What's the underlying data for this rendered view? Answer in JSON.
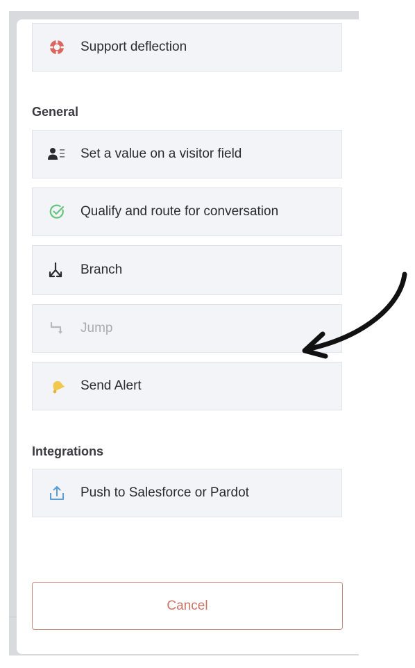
{
  "items_top": [
    {
      "label": "Support deflection",
      "icon": "lifebuoy-icon",
      "icon_color": "#d9675d"
    }
  ],
  "general": {
    "heading": "General",
    "items": [
      {
        "label": "Set a value on a visitor field",
        "icon": "contact-card-icon"
      },
      {
        "label": "Qualify and route for conversation",
        "icon": "check-circle-icon",
        "icon_color": "#63c47d"
      },
      {
        "label": "Branch",
        "icon": "branch-icon"
      },
      {
        "label": "Jump",
        "icon": "jump-icon",
        "disabled": true
      },
      {
        "label": "Send Alert",
        "icon": "bell-icon",
        "icon_color": "#f1c84b"
      }
    ]
  },
  "integrations": {
    "heading": "Integrations",
    "items": [
      {
        "label": "Push to Salesforce or Pardot",
        "icon": "upload-icon",
        "icon_color": "#5b9ed6"
      }
    ]
  },
  "footer": {
    "cancel_label": "Cancel"
  },
  "colors": {
    "card_bg": "#f3f4f7",
    "cancel_text": "#c87466",
    "cancel_border": "#c98a82"
  }
}
